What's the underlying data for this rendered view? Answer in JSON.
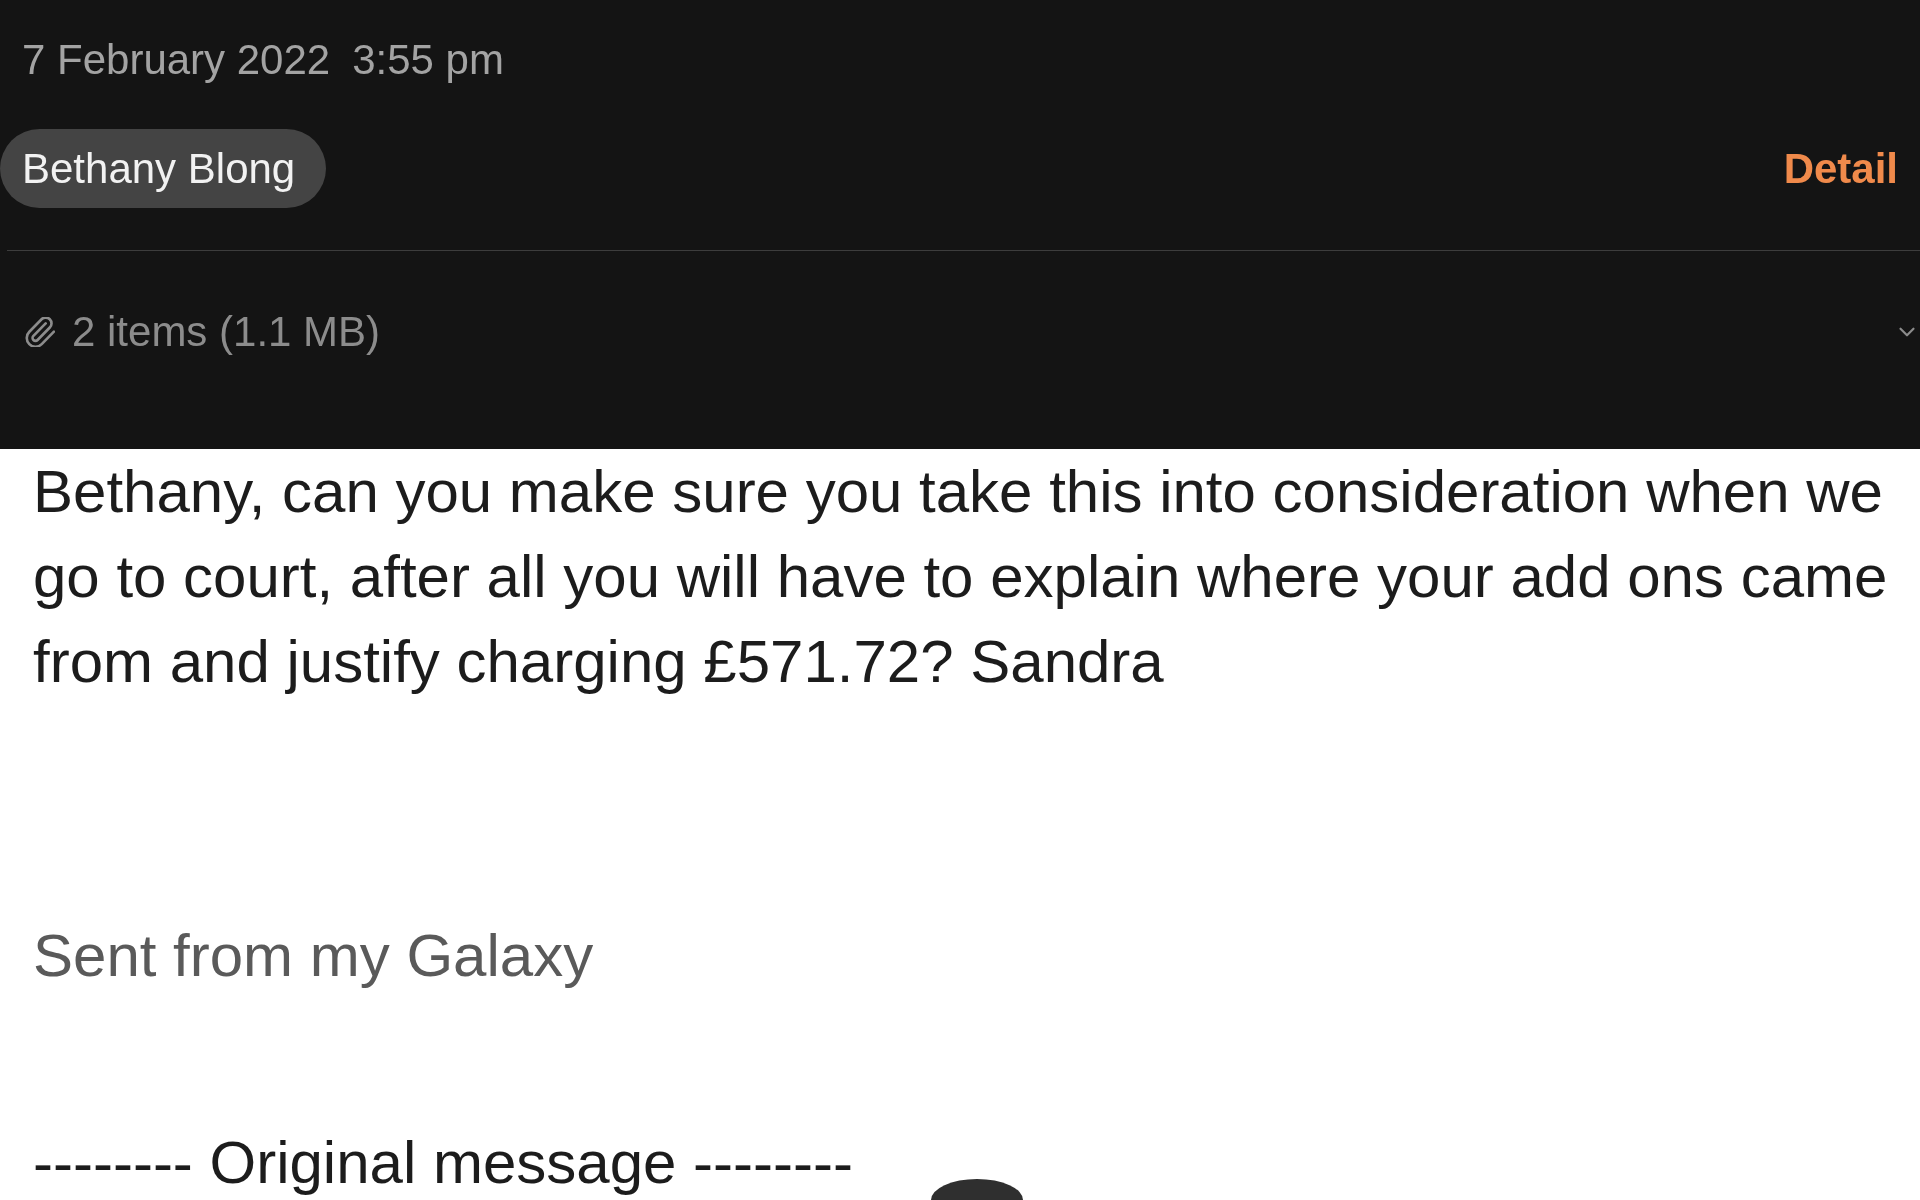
{
  "message_header": {
    "date": "7 February 2022",
    "time": "3:55 pm",
    "recipient_chip": "Bethany Blong",
    "details_link": "Detail",
    "attachments": {
      "summary": "2 items (1.1 MB)",
      "expanded": false
    }
  },
  "body": {
    "paragraphs": [
      "Bethany, can you make sure you take this into consideration when we go to court, after all you will have to explain where your add ons came from and justify charging £571.72? Sandra"
    ],
    "signature": "Sent from my Galaxy",
    "quote_separator": "-------- Original message --------"
  }
}
